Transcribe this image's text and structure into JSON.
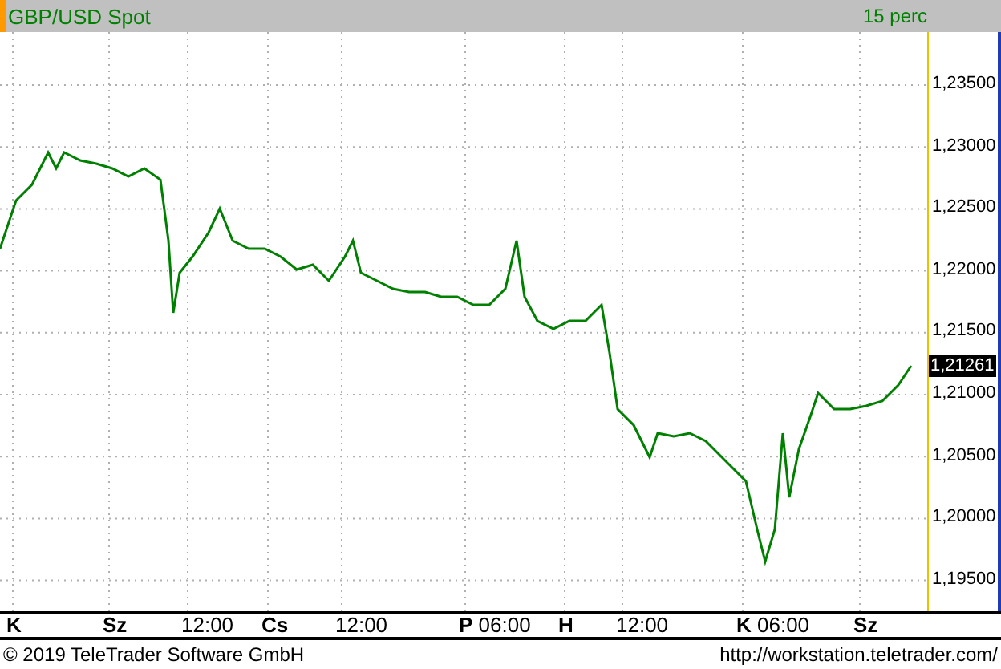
{
  "header": {
    "title": "GBP/USD Spot",
    "interval": "15 perc"
  },
  "chart": {
    "price_axis": [
      "1,23500",
      "1,23000",
      "1,22500",
      "1,22000",
      "1,21500",
      "1,21000",
      "1,20500",
      "1,20000",
      "1,19500"
    ],
    "last_price": "1,21261",
    "time_axis": [
      {
        "day": "K"
      },
      {
        "day": "Sz"
      },
      {
        "time": "12:00"
      },
      {
        "day": "Cs"
      },
      {
        "time": "12:00"
      },
      {
        "day": "P",
        "time": "06:00"
      },
      {
        "day": "H"
      },
      {
        "time": "12:00"
      },
      {
        "day": "K",
        "time": "06:00"
      },
      {
        "day": "Sz"
      }
    ]
  },
  "footer": {
    "copyright": "© 2019 TeleTrader Software GmbH",
    "url": "http://workstation.teletrader.com/"
  }
}
